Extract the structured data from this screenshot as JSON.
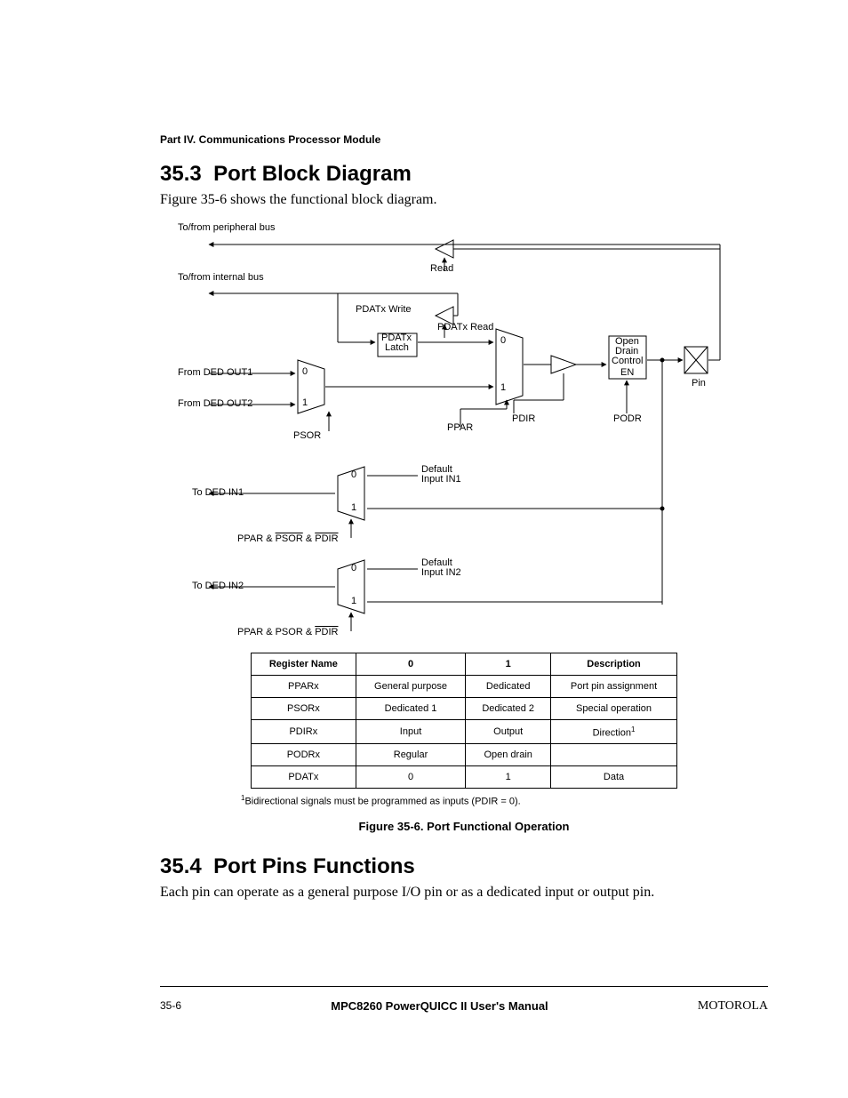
{
  "part_header": "Part IV.  Communications Processor Module",
  "sections": {
    "s1": {
      "num": "35.3",
      "title": "Port Block Diagram",
      "para": "Figure 35-6 shows the functional block diagram."
    },
    "s2": {
      "num": "35.4",
      "title": "Port Pins Functions",
      "para": "Each pin can operate as a general purpose I/O pin or as a dedicated input or output pin."
    }
  },
  "diagram": {
    "labels": {
      "periph_bus": "To/from peripheral bus",
      "internal_bus": "To/from internal bus",
      "read": "Read",
      "pdatx_write": "PDATx Write",
      "pdatx_read": "PDATx Read",
      "pdatx_latch_l1": "PDATx",
      "pdatx_latch_l2": "Latch",
      "from_ded_out1": "From DED OUT1",
      "from_ded_out2": "From DED OUT2",
      "psor": "PSOR",
      "ppar": "PPAR",
      "pdir": "PDIR",
      "open_l1": "Open",
      "open_l2": "Drain",
      "open_l3": "Control",
      "en": "EN",
      "podr": "PODR",
      "pin": "Pin",
      "to_ded_in1": "To DED IN1",
      "to_ded_in2": "To DED IN2",
      "default_in1_l1": "Default",
      "default_in1_l2": "Input IN1",
      "default_in2_l1": "Default",
      "default_in2_l2": "Input IN2",
      "cond1_a": "PPAR & ",
      "cond1_b": "PSOR",
      "cond1_c": " & ",
      "cond1_d": "PDIR",
      "cond2_a": "PPAR & PSOR & ",
      "cond2_b": "PDIR",
      "mux0": "0",
      "mux1": "1"
    }
  },
  "table": {
    "headers": [
      "Register Name",
      "0",
      "1",
      "Description"
    ],
    "rows": [
      [
        "PPARx",
        "General purpose",
        "Dedicated",
        "Port pin assignment"
      ],
      [
        "PSORx",
        "Dedicated 1",
        "Dedicated 2",
        "Special operation"
      ],
      [
        "PDIRx",
        "Input",
        "Output",
        "Direction"
      ],
      [
        "PODRx",
        "Regular",
        "Open drain",
        ""
      ],
      [
        "PDATx",
        "0",
        "1",
        "Data"
      ]
    ],
    "footnote_sup": "1",
    "footnote": "Bidirectional signals must be programmed as inputs (PDIR = 0)."
  },
  "figcaption": "Figure 35-6. Port Functional Operation",
  "footer": {
    "pageno": "35-6",
    "manual": "MPC8260 PowerQUICC II User's Manual",
    "brand": "MOTOROLA"
  }
}
